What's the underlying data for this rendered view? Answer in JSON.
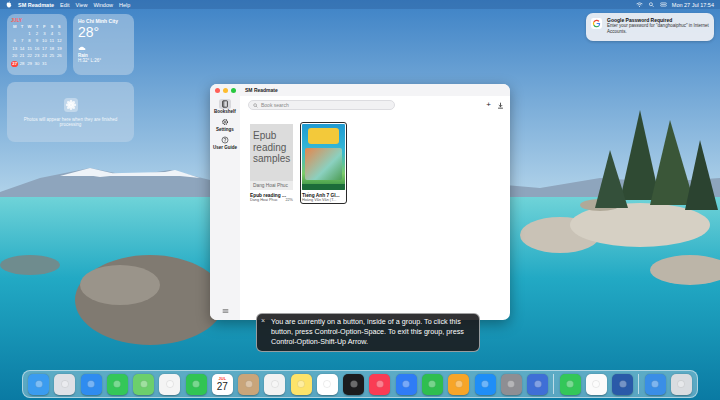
{
  "menu_bar": {
    "app": "SM Readmate",
    "items": [
      "Edit",
      "View",
      "Window",
      "Help"
    ],
    "clock": "Mon 27 Jul 17:54"
  },
  "widgets": {
    "calendar": {
      "month": "JULY",
      "weekdays": [
        "M",
        "T",
        "W",
        "T",
        "F",
        "S",
        "S"
      ],
      "today": "27",
      "weeks": [
        [
          null,
          null,
          "1",
          "2",
          "3",
          "4",
          "5"
        ],
        [
          "6",
          "7",
          "8",
          "9",
          "10",
          "11",
          "12"
        ],
        [
          "13",
          "14",
          "15",
          "16",
          "17",
          "18",
          "19"
        ],
        [
          "20",
          "21",
          "22",
          "23",
          "24",
          "25",
          "26"
        ],
        [
          "27",
          "28",
          "29",
          "30",
          "31",
          null,
          null
        ]
      ]
    },
    "weather": {
      "city": "Ho Chi Minh City",
      "temp": "28°",
      "condition": "Rain",
      "range": "H:32° L:26°"
    },
    "photos": {
      "message": "Photos will appear here when they are finished processing"
    }
  },
  "notification": {
    "title": "Google Password Required",
    "body": "Enter your password for \"danghoaiphuc\" in Internet Accounts."
  },
  "window": {
    "title": "SM Readmate",
    "sidebar": {
      "items": [
        {
          "label": "Bookshelf",
          "selected": true
        },
        {
          "label": "Settings",
          "selected": false
        },
        {
          "label": "User Guide",
          "selected": false
        }
      ]
    },
    "search": {
      "placeholder": "Book search"
    },
    "toolbar": {
      "add": "+"
    },
    "books": [
      {
        "kind": "text-cover",
        "cover_title": "Epub reading samples",
        "cover_author": "Dang Hoai Phuc",
        "title": "Epub reading ...",
        "author": "Dang Hoai Phuc",
        "progress": "22%",
        "selected": false
      },
      {
        "kind": "image-cover",
        "title": "Tiếng Anh 7 Gl...",
        "author": "Hoàng Văn Vân (T...",
        "selected": true
      }
    ]
  },
  "voiceover": {
    "close": "×",
    "text": "You are currently on a button, inside of a group. To click this button, press Control-Option-Space. To exit this group, press Control-Option-Shift-Up Arrow."
  },
  "dock": {
    "items": [
      {
        "kind": "app",
        "color": "#3b9cf0"
      },
      {
        "kind": "app",
        "color": "#dfe1e6"
      },
      {
        "kind": "app",
        "color": "#2f8cf0"
      },
      {
        "kind": "app",
        "color": "#34c759"
      },
      {
        "kind": "app",
        "color": "#6ccf6c"
      },
      {
        "kind": "app",
        "color": "#f4f4f4"
      },
      {
        "kind": "app",
        "color": "#31c454"
      },
      {
        "kind": "calendar",
        "color": "#ffffff",
        "month": "JUL",
        "day": "27"
      },
      {
        "kind": "app",
        "color": "#c9a57a"
      },
      {
        "kind": "app",
        "color": "#f2f2f2"
      },
      {
        "kind": "app",
        "color": "#fde36a"
      },
      {
        "kind": "app",
        "color": "#ffffff"
      },
      {
        "kind": "app",
        "color": "#1c1c1e"
      },
      {
        "kind": "app",
        "color": "#fa3c54"
      },
      {
        "kind": "app",
        "color": "#2f7cf6"
      },
      {
        "kind": "app",
        "color": "#2fbe4f"
      },
      {
        "kind": "app",
        "color": "#f7a528"
      },
      {
        "kind": "app",
        "color": "#1f8ef7"
      },
      {
        "kind": "app",
        "color": "#8e8e93"
      },
      {
        "kind": "app",
        "color": "#3f6fd6"
      },
      {
        "kind": "separator"
      },
      {
        "kind": "app",
        "color": "#34c759"
      },
      {
        "kind": "app",
        "color": "#fbfbfb"
      },
      {
        "kind": "app",
        "color": "#2a5aa8"
      },
      {
        "kind": "separator"
      },
      {
        "kind": "app",
        "color": "#3a8ee6"
      },
      {
        "kind": "app",
        "color": "#d9dce0"
      }
    ]
  }
}
